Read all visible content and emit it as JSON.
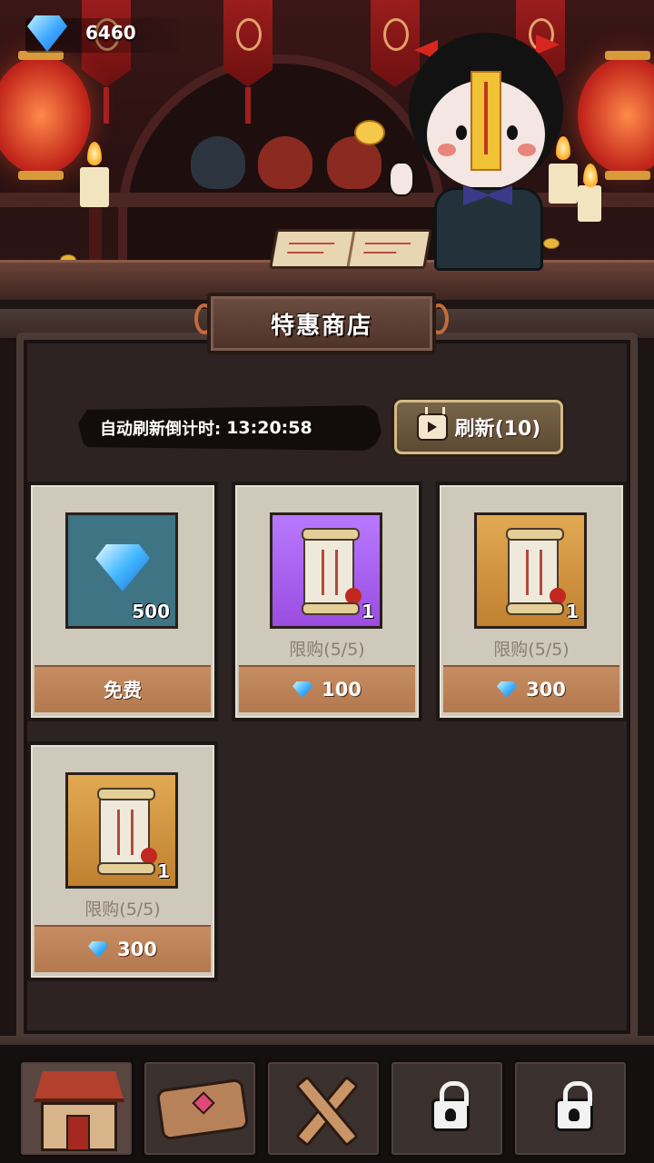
{
  "header": {
    "gem_count": "6460"
  },
  "shop": {
    "title": "特惠商店",
    "timer_label": "自动刷新倒计时:",
    "timer_value": "13:20:58",
    "refresh_label": "刷新(10)"
  },
  "items": [
    {
      "name": "diamond",
      "qty": "500",
      "limit": "",
      "price": "免费",
      "price_currency": ""
    },
    {
      "name": "scroll-purple",
      "qty": "1",
      "limit": "限购(5/5)",
      "price": "100",
      "price_currency": "gem"
    },
    {
      "name": "scroll-gold",
      "qty": "1",
      "limit": "限购(5/5)",
      "price": "300",
      "price_currency": "gem"
    },
    {
      "name": "scroll-gold",
      "qty": "1",
      "limit": "限购(5/5)",
      "price": "300",
      "price_currency": "gem"
    }
  ],
  "nav": {
    "tabs": [
      {
        "icon": "shop-icon",
        "active": true
      },
      {
        "icon": "map-icon",
        "active": false
      },
      {
        "icon": "crossed-swords-icon",
        "active": false
      },
      {
        "icon": "lock-icon",
        "active": false
      },
      {
        "icon": "lock-icon",
        "active": false
      }
    ]
  },
  "colors": {
    "background": "#1c1514",
    "card": "#cfc9bb",
    "price_bar": "#c78d62",
    "gem": "#3fb2ff"
  }
}
